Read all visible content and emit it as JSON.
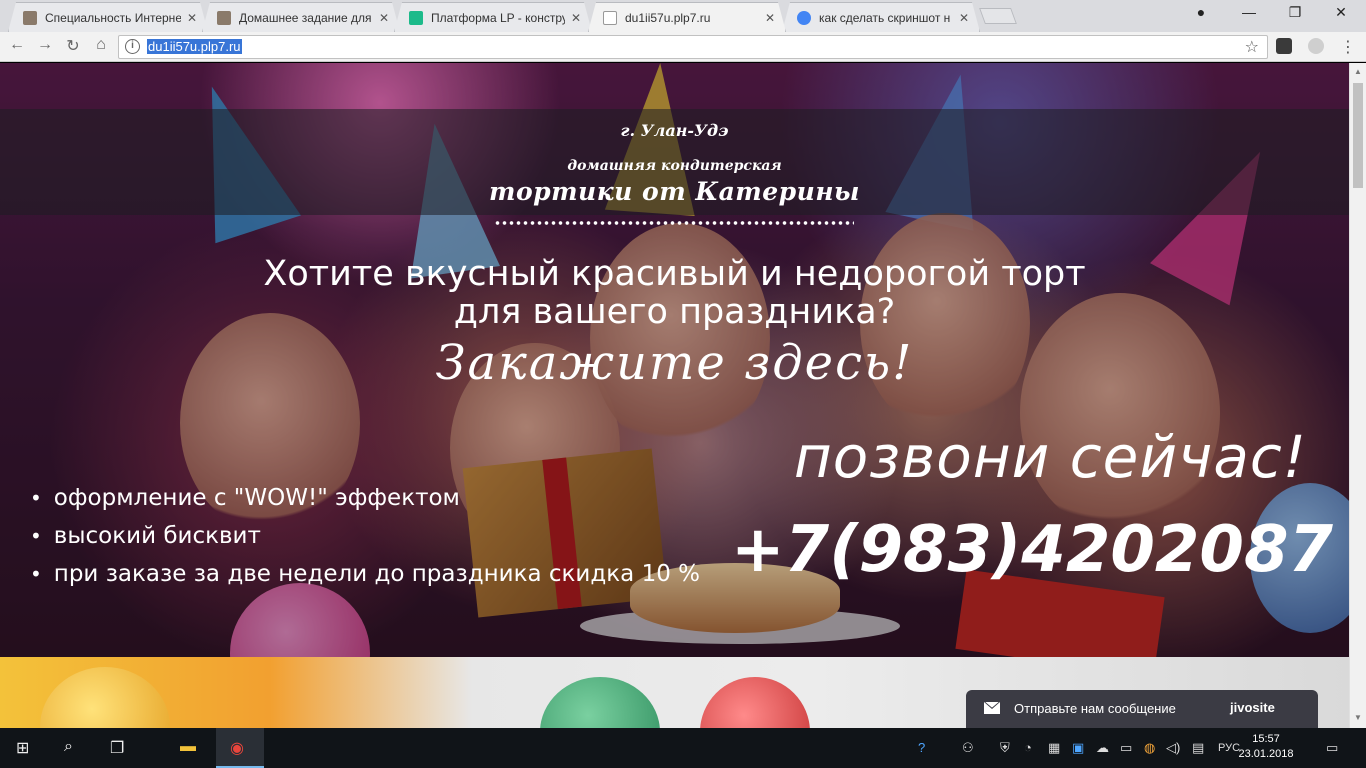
{
  "browser": {
    "tabs": [
      {
        "title": "Специальность Интерне",
        "active": false
      },
      {
        "title": "Домашнее задание для",
        "active": false
      },
      {
        "title": "Платформа LP - констру",
        "active": false
      },
      {
        "title": "du1ii57u.plp7.ru",
        "active": true
      },
      {
        "title": "как сделать скриншот н",
        "active": false
      }
    ],
    "url": "du1ii57u.plp7.ru"
  },
  "page": {
    "city": "г. Улан-Удэ",
    "subtitle": "домашняя кондитерская",
    "brand": "тортики от Катерины",
    "headline_line1": "Хотите вкусный красивый и недорогой торт",
    "headline_line2": "для вашего  праздника?",
    "cta_script": "Закажите здесь!",
    "features": [
      "оформление с \"WOW!\" эффектом",
      "высокий бисквит",
      "при заказе за две недели до праздника скидка 10 %"
    ],
    "call_now": "позвони сейчас!",
    "phone": "+7(983)4202087"
  },
  "chat_widget": {
    "message": "Отправьте нам сообщение",
    "logo": "jivosite"
  },
  "taskbar": {
    "language": "РУС",
    "time": "15:57",
    "date": "23.01.2018"
  }
}
